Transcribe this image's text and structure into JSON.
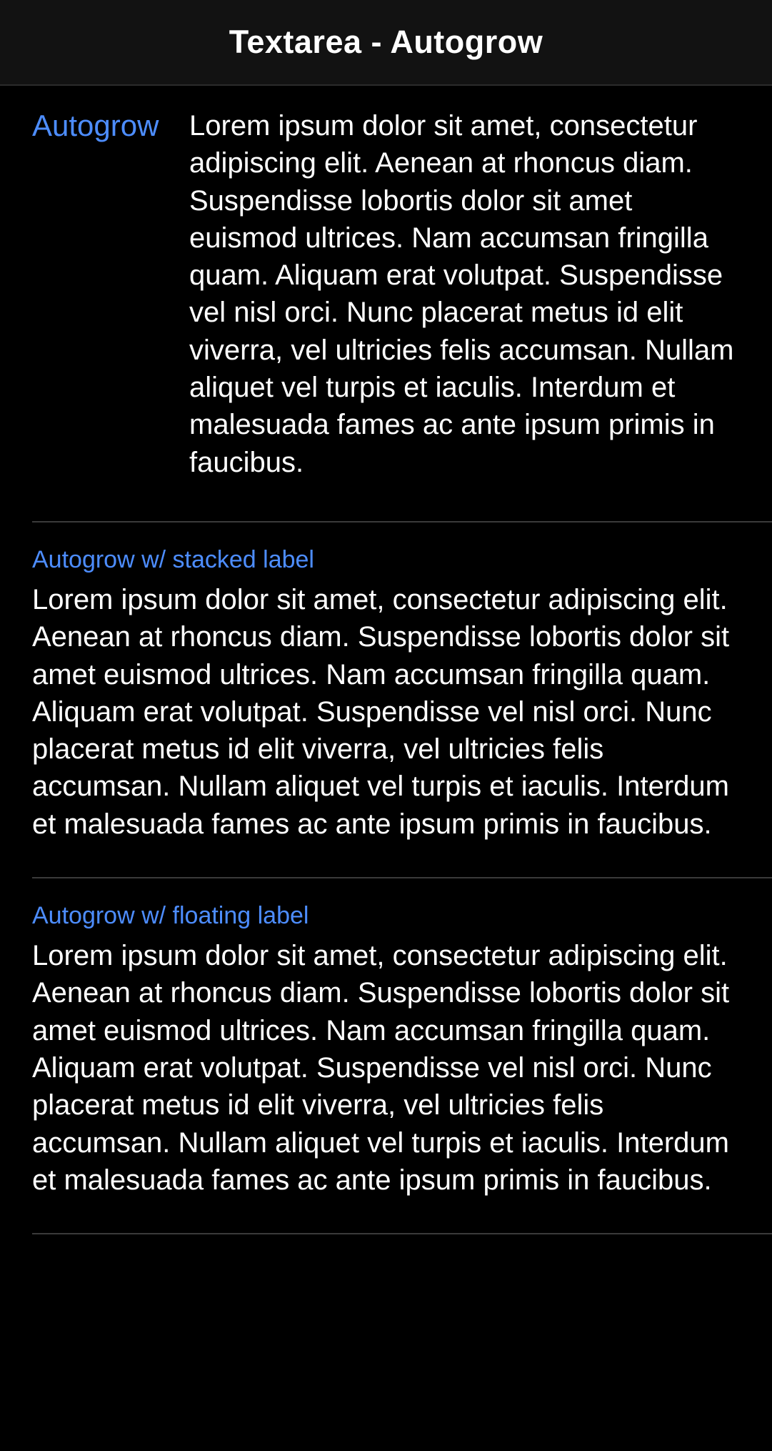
{
  "toolbar": {
    "title": "Textarea - Autogrow"
  },
  "items": [
    {
      "label": "Autogrow",
      "value": "Lorem ipsum dolor sit amet, consectetur adipiscing elit. Aenean at rhoncus diam. Suspendisse lobortis dolor sit amet euismod ultrices. Nam accumsan fringilla quam. Aliquam erat volutpat. Suspendisse vel nisl orci. Nunc placerat metus id elit viverra, vel ultricies felis accumsan. Nullam aliquet vel turpis et iaculis. Interdum et malesuada fames ac ante ipsum primis in faucibus."
    },
    {
      "label": "Autogrow w/ stacked label",
      "value": "Lorem ipsum dolor sit amet, consectetur adipiscing elit. Aenean at rhoncus diam. Suspendisse lobortis dolor sit amet euismod ultrices. Nam accumsan fringilla quam. Aliquam erat volutpat. Suspendisse vel nisl orci. Nunc placerat metus id elit viverra, vel ultricies felis accumsan. Nullam aliquet vel turpis et iaculis. Interdum et malesuada fames ac ante ipsum primis in faucibus."
    },
    {
      "label": "Autogrow w/ floating label",
      "value": "Lorem ipsum dolor sit amet, consectetur adipiscing elit. Aenean at rhoncus diam. Suspendisse lobortis dolor sit amet euismod ultrices. Nam accumsan fringilla quam. Aliquam erat volutpat. Suspendisse vel nisl orci. Nunc placerat metus id elit viverra, vel ultricies felis accumsan. Nullam aliquet vel turpis et iaculis. Interdum et malesuada fames ac ante ipsum primis in faucibus."
    }
  ],
  "colors": {
    "background": "#000000",
    "toolbar_background": "#121212",
    "label_accent": "#4d8dff",
    "text": "#ffffff",
    "divider": "#3a3a3a"
  }
}
